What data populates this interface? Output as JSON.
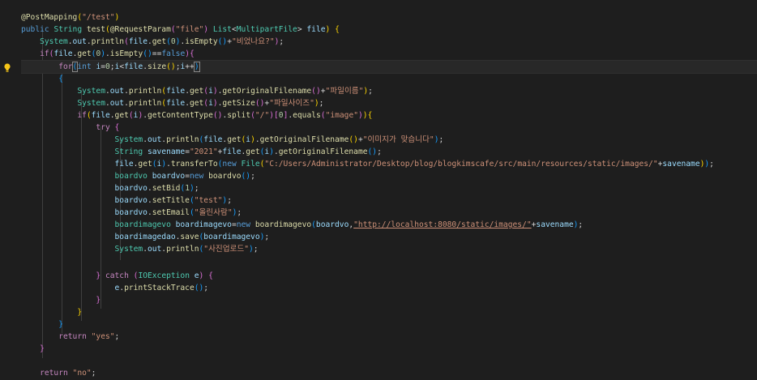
{
  "editor": {
    "language": "java",
    "theme_colors": {
      "background": "#1e1e1e",
      "keyword": "#569cd6",
      "control": "#c586c0",
      "type": "#4ec9b0",
      "method": "#dcdcaa",
      "variable": "#9cdcfe",
      "string": "#ce9178",
      "number": "#b5cea8"
    },
    "gutter": {
      "lightbulb_icon": "lightbulb-icon"
    },
    "lines": [
      "@PostMapping(\"/test\")",
      "public String test(@RequestParam(\"file\") List<MultipartFile> file) {",
      "    System.out.println(file.get(0).isEmpty()+\"비었나요?\");",
      "    if(file.get(0).isEmpty()==false){",
      "        for(int i=0;i<file.size();i++)",
      "        {",
      "            System.out.println(file.get(i).getOriginalFilename()+\"파일이름\");",
      "            System.out.println(file.get(i).getSize()+\"파일사이즈\");",
      "            if(file.get(i).getContentType().split(\"/\")[0].equals(\"image\")){",
      "                try {",
      "                    System.out.println(file.get(i).getOriginalFilename()+\"이미지가 맞습니다\");",
      "                    String savename=\"2021\"+file.get(i).getOriginalFilename();",
      "                    file.get(i).transferTo(new File(\"C:/Users/Administrator/Desktop/blog/blogkimscafe/src/main/resources/static/images/\"+savename));",
      "                    boardvo boardvo=new boardvo();",
      "                    boardvo.setBid(1);",
      "                    boardvo.setTitle(\"test\");",
      "                    boardvo.setEmail(\"올린사람\");",
      "                    boardimagevo boardimagevo=new boardimagevo(boardvo,\"http://localhost:8080/static/images/\"+savename);",
      "                    boardimagedao.save(boardimagevo);",
      "                    System.out.println(\"사진업로드\");",
      "",
      "                } catch (IOException e) {",
      "                    e.printStackTrace();",
      "                }",
      "            }",
      "        }",
      "        return \"yes\";",
      "    }",
      "",
      "    return \"no\";"
    ]
  }
}
